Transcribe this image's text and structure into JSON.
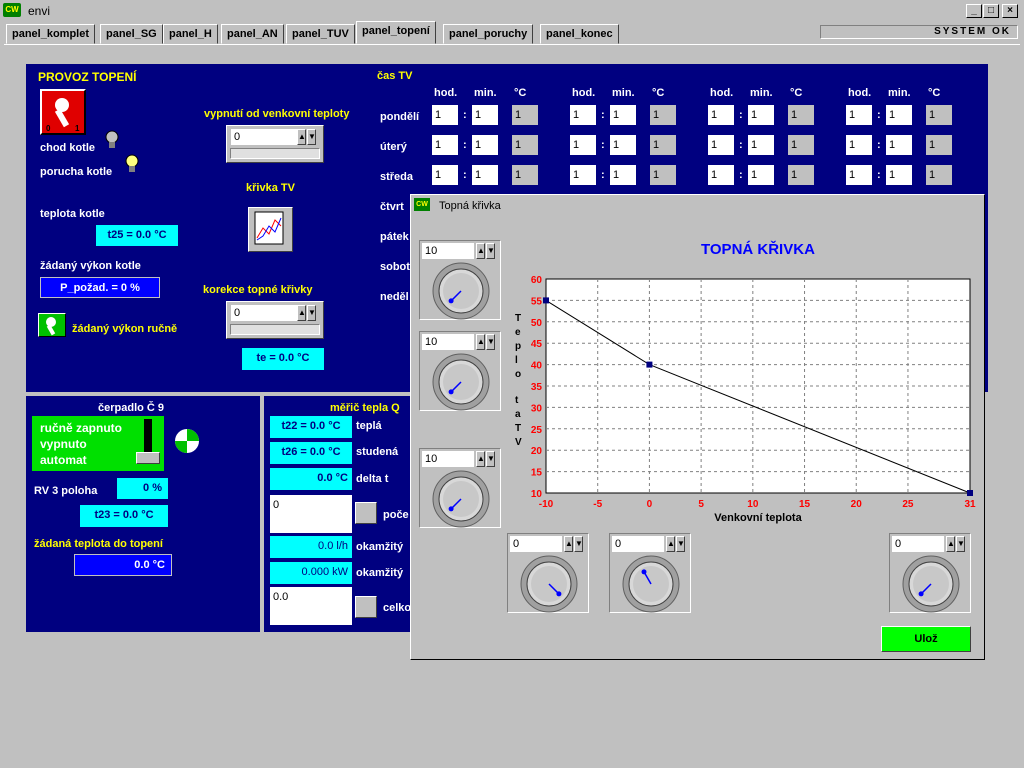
{
  "window": {
    "title": "envi",
    "system_status": "SYSTEM OK"
  },
  "tabs": [
    "panel_komplet",
    "panel_SG",
    "panel_H",
    "panel_AN",
    "panel_TUV",
    "panel_topení",
    "panel_poruchy",
    "panel_konec"
  ],
  "heating": {
    "title": "PROVOZ TOPENÍ",
    "chod_kotle": "chod kotle",
    "porucha_kotle": "porucha kotle",
    "vypnuti_label": "vypnutí od venkovní teploty",
    "vypnuti_value": "0",
    "krivka_label": "křivka TV",
    "teplota_kotle": "teplota kotle",
    "t25": "t25 =  0.0 °C",
    "zadany_vykon": "žádaný výkon kotle",
    "p_pozad": "P_požad. =  0 %",
    "korekce_label": "korekce topné křivky",
    "korekce_value": "0",
    "vykon_rucne": "žádaný výkon ručně",
    "te": "te =  0.0 °C"
  },
  "tv": {
    "title": "čas TV",
    "headers": [
      "hod.",
      "min.",
      "°C"
    ],
    "days": [
      "pondělí",
      "úterý",
      "středa",
      "čtvrtek",
      "pátek",
      "sobota",
      "neděle"
    ],
    "days_visible": [
      "pondělí",
      "úterý",
      "středa",
      "čtvrt",
      "pátek",
      "sobot",
      "neděl"
    ],
    "cell_value": "1"
  },
  "pump": {
    "title": "čerpadlo Č 9",
    "options": [
      "ručně zapnuto",
      "vypnuto",
      "automat"
    ],
    "rv3": "RV 3 poloha",
    "rv3_value": "0 %",
    "t23": "t23 =  0.0 °C",
    "zadana": "žádaná teplota do topení",
    "zadana_value": "0.0 °C"
  },
  "meter": {
    "title": "měřič tepla Q",
    "t22": "t22 =  0.0 °C",
    "tepla": "teplá",
    "t26": "t26 =  0.0 °C",
    "studena": "studená",
    "delta_value": "0.0 °C",
    "delta": "delta t",
    "poc_value": "0",
    "poc": "poče",
    "flow": "0.0 l/h",
    "okamzity1": "okamžitý",
    "power": "0.000 kW",
    "okamzity2": "okamžitý",
    "celk_value": "0.0",
    "celk": "celko"
  },
  "dialog": {
    "title": "Topná křivka",
    "heading": "TOPNÁ KŘIVKA",
    "left_knobs": [
      "10",
      "10",
      "10"
    ],
    "bottom_knobs": [
      "0",
      "0",
      "0"
    ],
    "save": "Ulož"
  },
  "chart_data": {
    "type": "line",
    "xlabel": "Venkovní teplota",
    "ylabel": "Teplota TV",
    "xticks": [
      "-10",
      "-5",
      "0",
      "5",
      "10",
      "15",
      "20",
      "25",
      "31"
    ],
    "yticks": [
      "60",
      "55",
      "50",
      "45",
      "40",
      "35",
      "30",
      "25",
      "20",
      "15",
      "10"
    ],
    "xlim": [
      -10,
      31
    ],
    "ylim": [
      10,
      60
    ],
    "x": [
      -10,
      0,
      31
    ],
    "y": [
      55,
      40,
      10
    ],
    "grid": true,
    "colors": {
      "line": "#000000",
      "ticks": "#ff0000",
      "title": "#0000ff"
    }
  }
}
